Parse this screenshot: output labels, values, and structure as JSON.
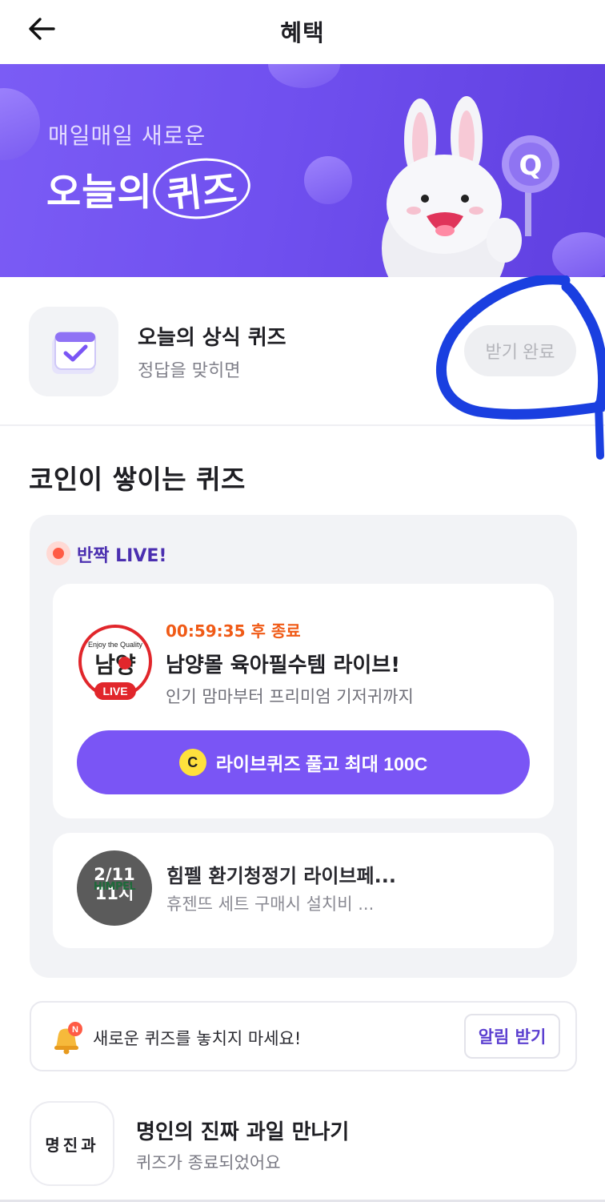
{
  "header": {
    "title": "혜택",
    "back_icon": "arrow-left-icon"
  },
  "banner": {
    "subtitle": "매일매일 새로운",
    "title_prefix": "오늘의",
    "title_highlight": "퀴즈",
    "mascot_badge": "Q"
  },
  "today_quiz": {
    "title": "오늘의 상식 퀴즈",
    "subtitle": "정답을 맞히면",
    "button_label": "받기 완료",
    "icon": "calendar-check-icon"
  },
  "section": {
    "title": "코인이 쌓이는 퀴즈"
  },
  "live": {
    "label": "반짝 LIVE!",
    "current": {
      "logo_tagline": "Enjoy the Quality",
      "logo_name": "남양",
      "logo_live": "LIVE",
      "timer": "00:59:35 후 종료",
      "title": "남양몰 육아필수템 라이브!",
      "subtitle": "인기 맘마부터 프리미엄 기저귀까지",
      "cta_coin": "C",
      "cta_label": "라이브퀴즈 풀고 최대 100C"
    },
    "next": {
      "badge_date": "2/11",
      "badge_time": "11시",
      "badge_brand": "HIMPEL",
      "title": "힘펠 환기청정기 라이브페...",
      "subtitle": "휴젠뜨 세트 구매시 설치비 ..."
    }
  },
  "notify": {
    "text": "새로운 퀴즈를 놓치지 마세요!",
    "button_label": "알림 받기",
    "bell_badge": "N"
  },
  "ended_quiz": {
    "logo_text": "명진과",
    "title": "명인의 진짜 과일 만나기",
    "subtitle": "퀴즈가 종료되었어요"
  },
  "colors": {
    "brand_purple": "#7a55f5",
    "timer_orange": "#f05a16",
    "live_red": "#ff5b45",
    "annotation_blue": "#1a3fe0"
  }
}
